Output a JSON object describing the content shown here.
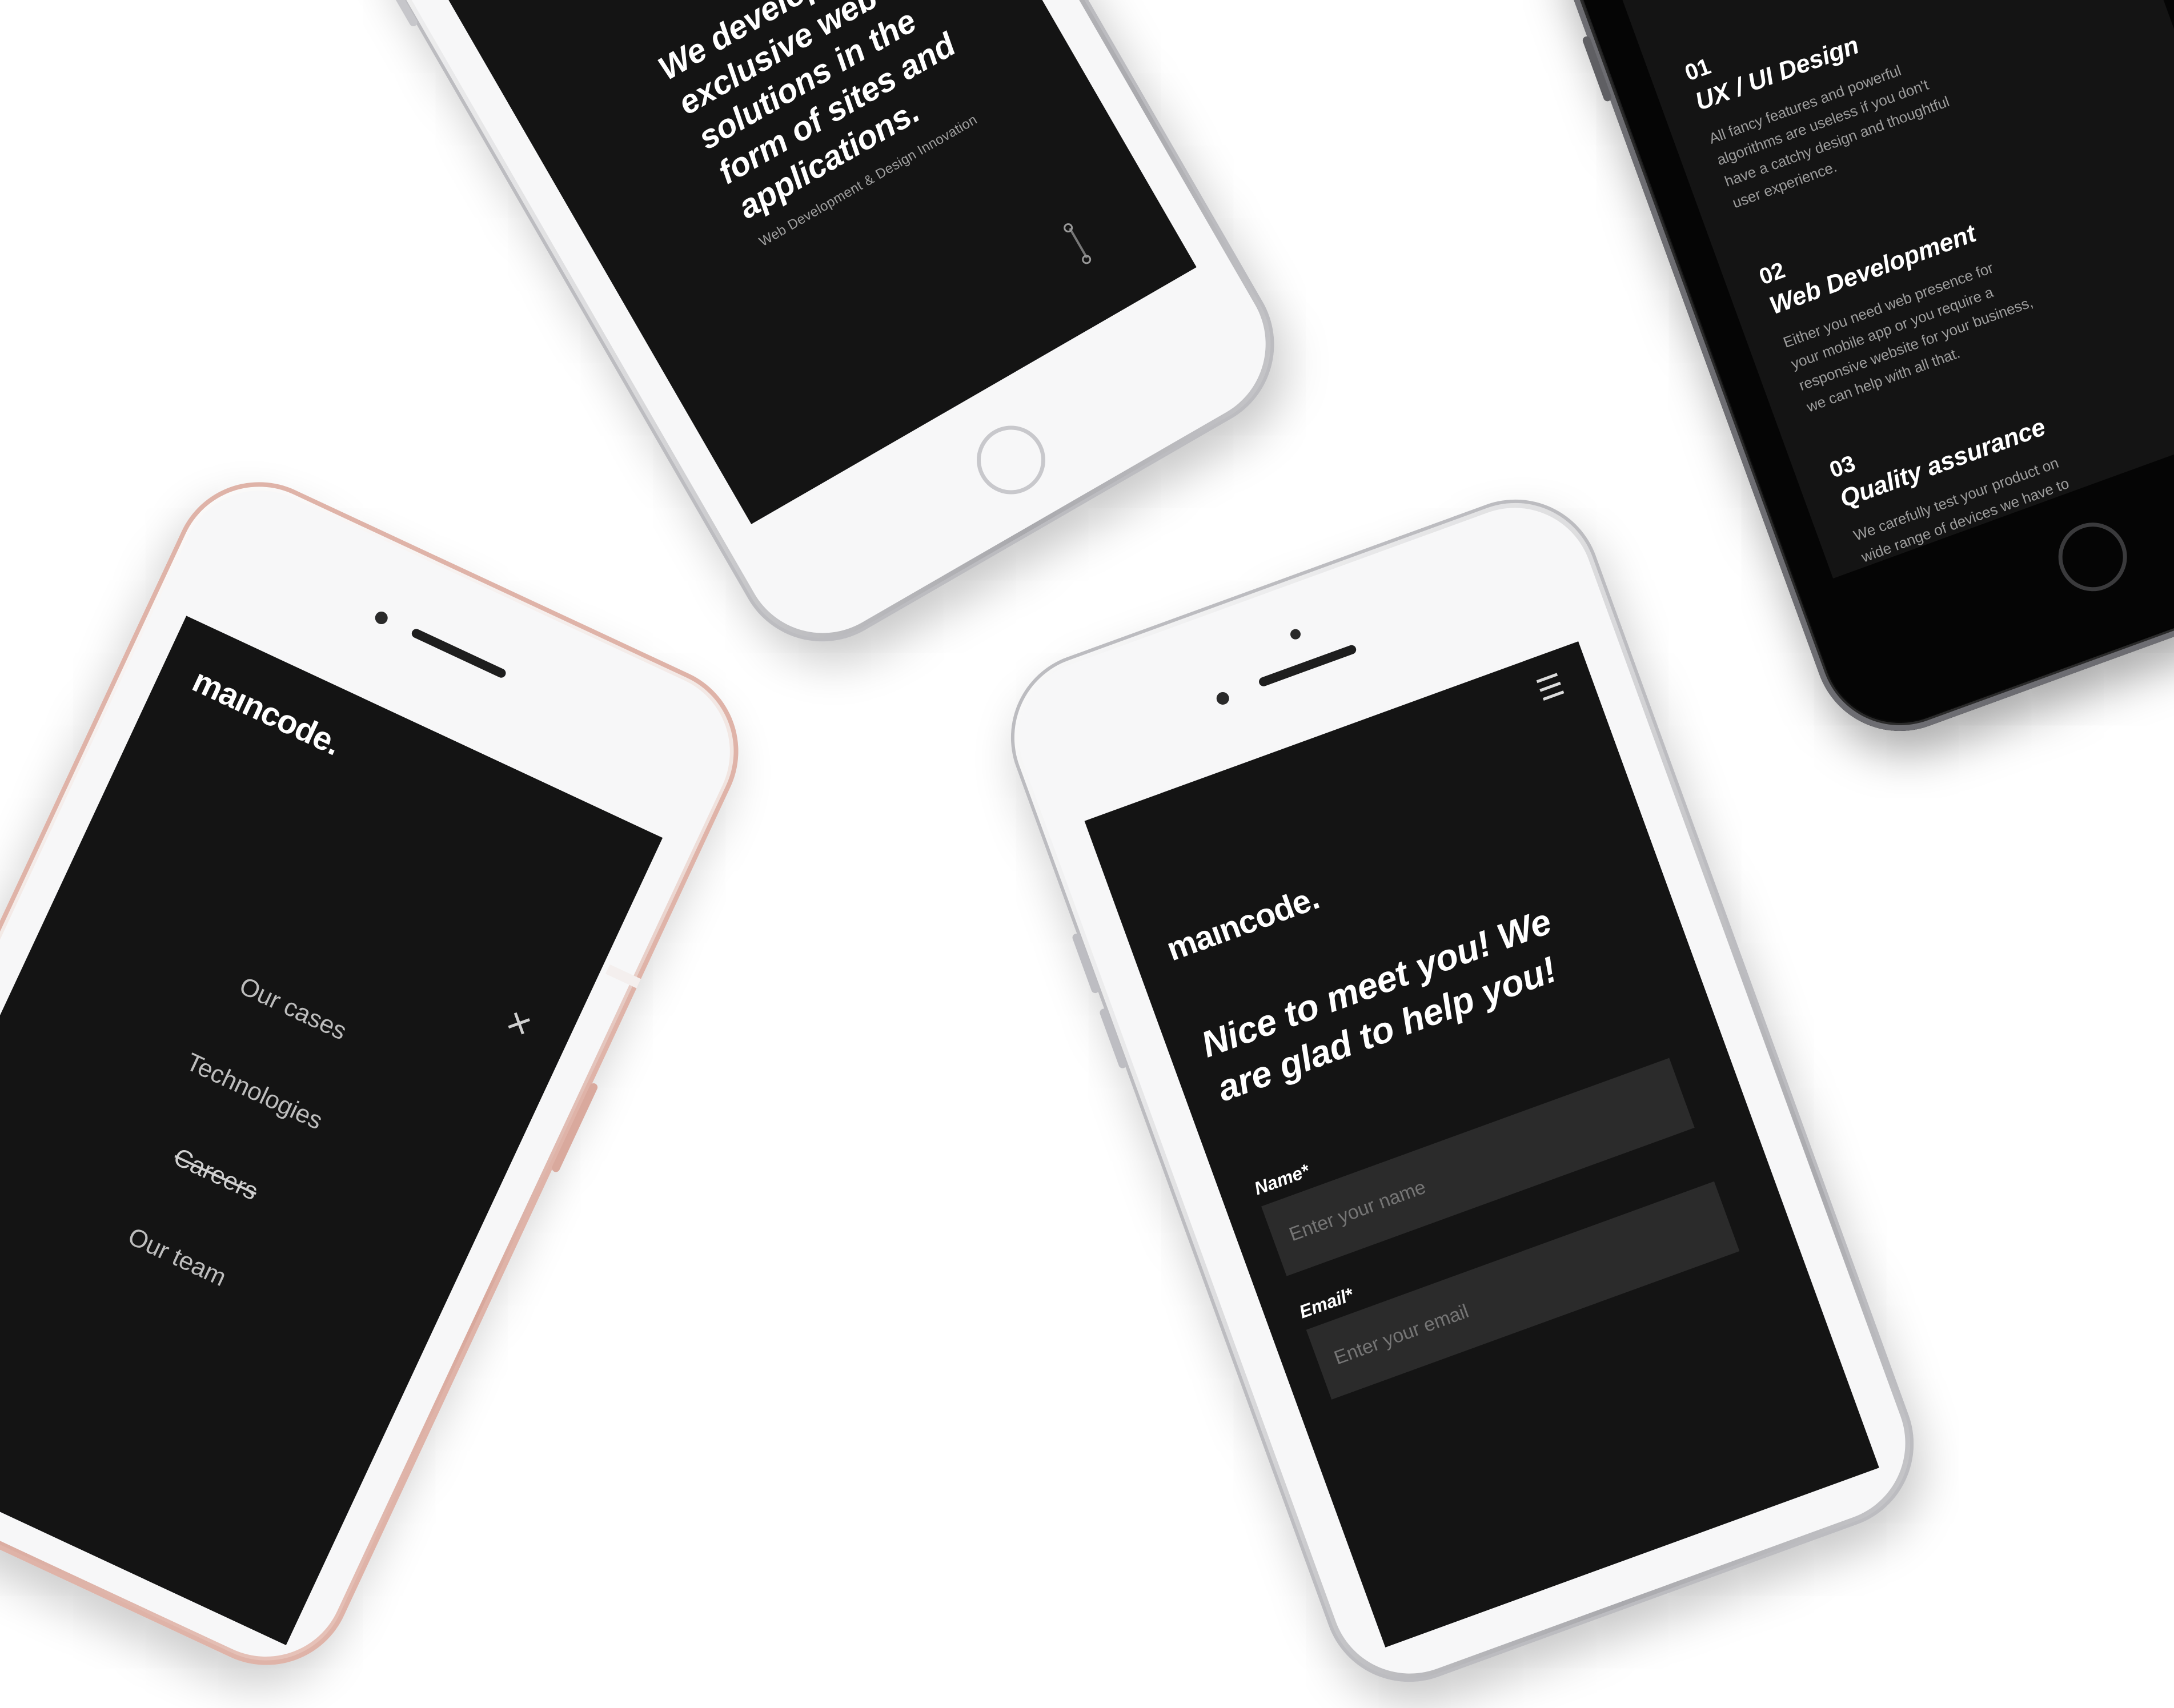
{
  "brand": {
    "logo": "maıncode."
  },
  "phone_hero": {
    "headline": "We develops exclusive web solutions in the form of sites and applications.",
    "subline": "Web Development & Design Innovation"
  },
  "phone_menu": {
    "close_icon": "×",
    "items": [
      "Our cases",
      "Technologies",
      "Careers",
      "Our team"
    ]
  },
  "phone_contact": {
    "menu_icon": "☰",
    "title": "Nice to meet you! We are glad to help you!",
    "fields": [
      {
        "label": "Name*",
        "placeholder": "Enter your name"
      },
      {
        "label": "Email*",
        "placeholder": "Enter your email"
      }
    ]
  },
  "phone_services": {
    "items": [
      {
        "num": "01",
        "title": "UX / UI Design",
        "desc": "All fancy features and powerful algorithms are useless if you don't have a catchy design and thoughtful user experience."
      },
      {
        "num": "02",
        "title": "Web Development",
        "desc": "Either you need web presence for your mobile app or you require a responsive website for your business, we can help with all that."
      },
      {
        "num": "03",
        "title": "Quality assurance",
        "desc": "We carefully test your product on wide range of devices we have to ensure bug free result and the highest quality possible."
      }
    ]
  },
  "colors": {
    "screen": "#141414",
    "input": "#2b2b2b",
    "rose_gold": "#e3b8ad",
    "space_gray": "#111111"
  }
}
